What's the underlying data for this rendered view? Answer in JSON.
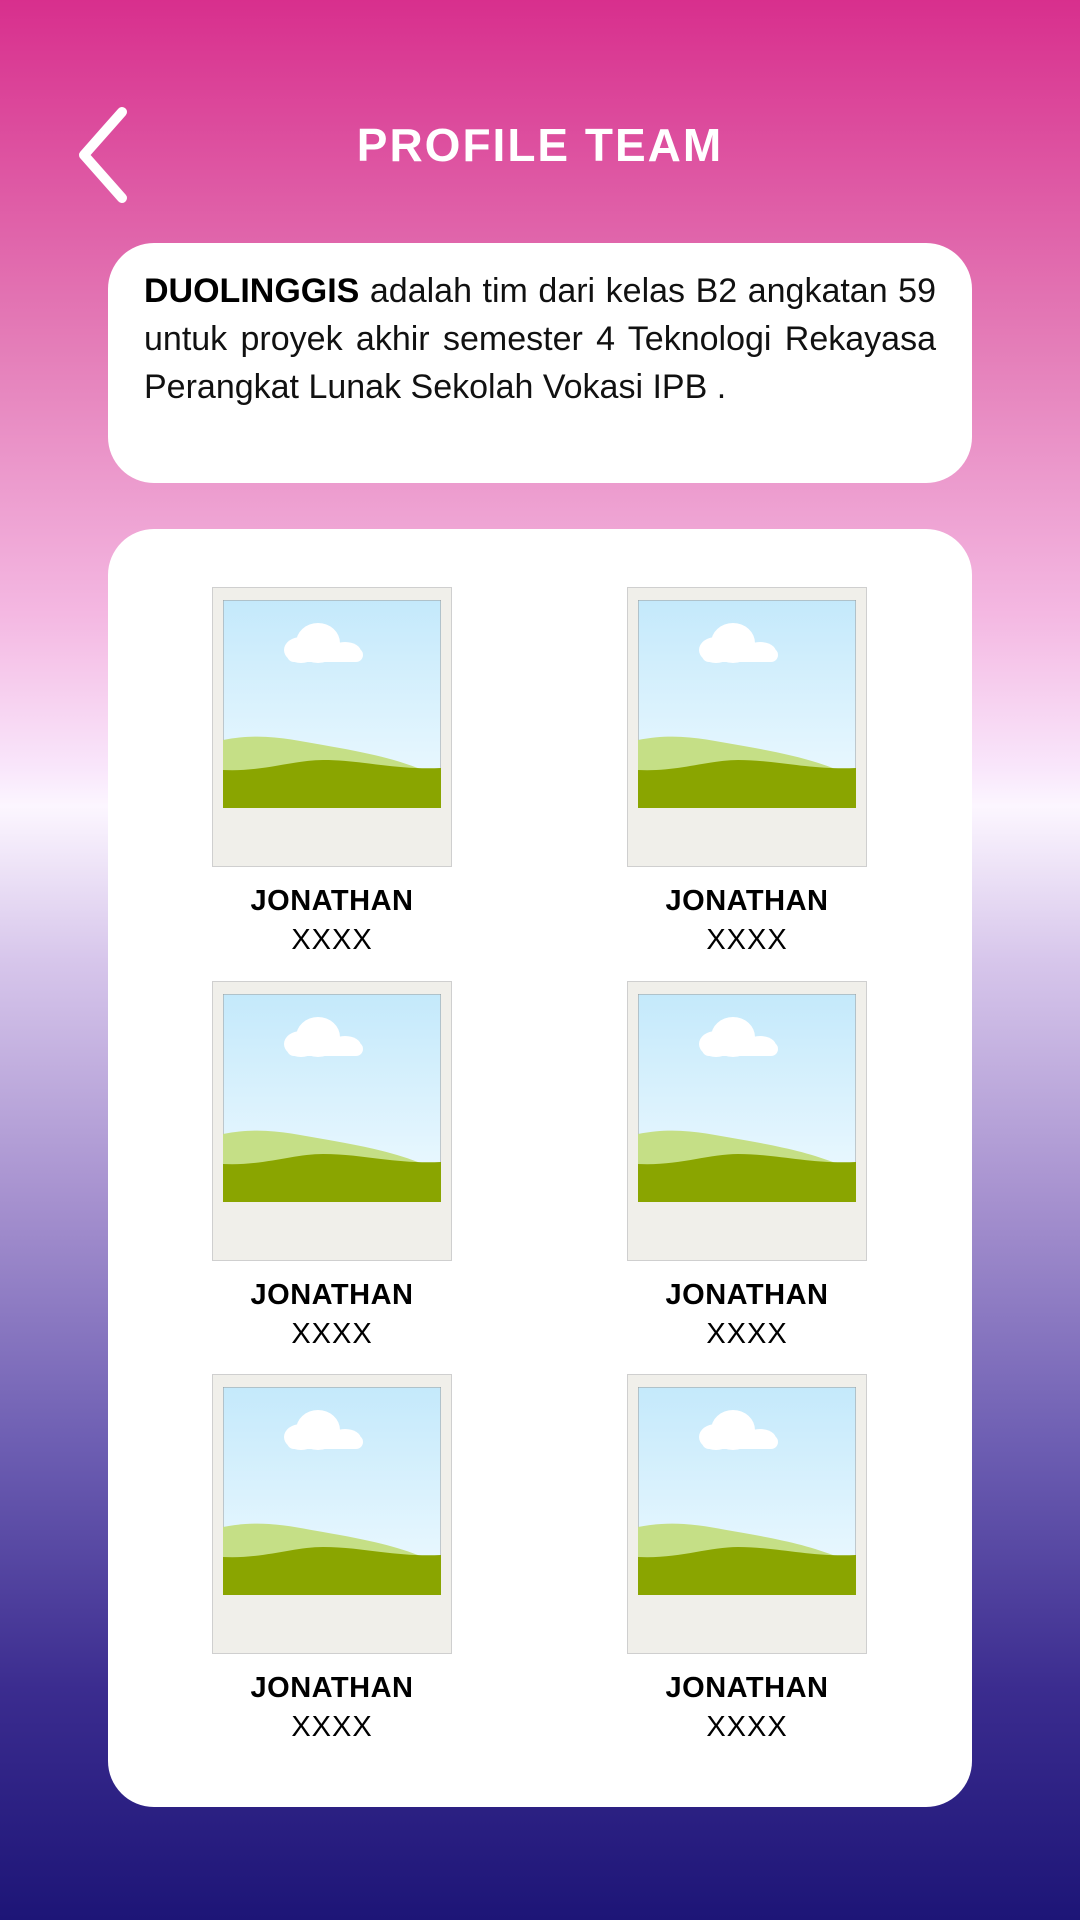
{
  "header": {
    "title": "PROFILE TEAM"
  },
  "description": {
    "team_name": "DUOLINGGIS",
    "text": " adalah tim dari kelas B2 angkatan 59 untuk proyek akhir semester 4 Teknologi Rekayasa Perangkat Lunak Sekolah Vokasi IPB ."
  },
  "members": [
    {
      "name": "JONATHAN",
      "role": "XXXX"
    },
    {
      "name": "JONATHAN",
      "role": "XXXX"
    },
    {
      "name": "JONATHAN",
      "role": "XXXX"
    },
    {
      "name": "JONATHAN",
      "role": "XXXX"
    },
    {
      "name": "JONATHAN",
      "role": "XXXX"
    },
    {
      "name": "JONATHAN",
      "role": "XXXX"
    }
  ],
  "icons": {
    "back": "chevron-left-icon",
    "photo_placeholder": "image-placeholder-icon"
  }
}
